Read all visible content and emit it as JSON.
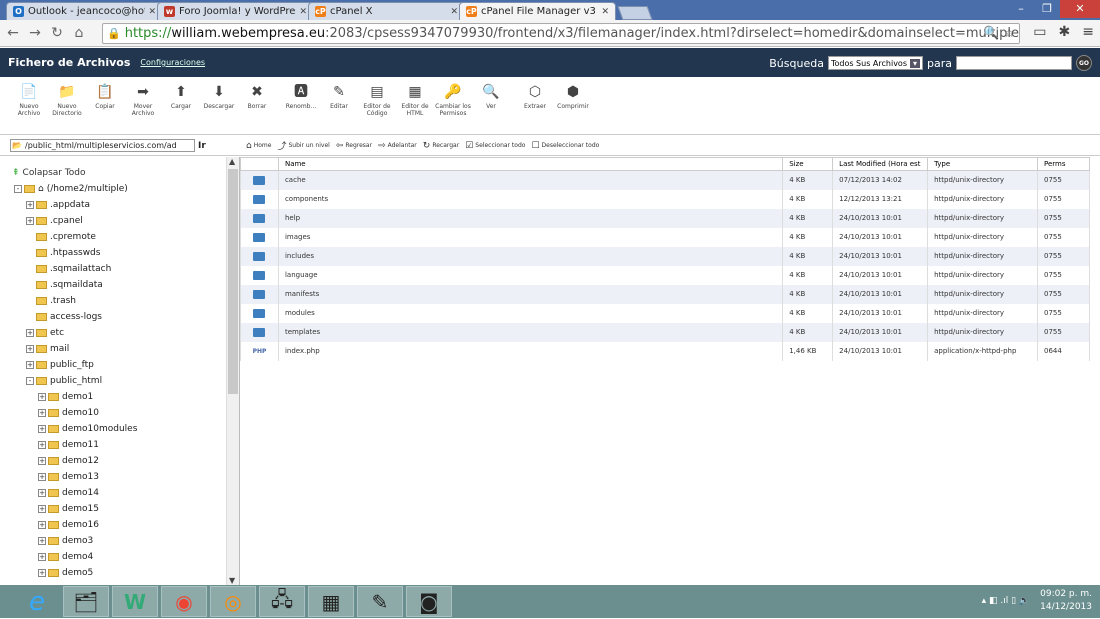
{
  "browser": {
    "tabs": [
      {
        "label": "Outlook - jeancoco@hotm",
        "icon": "outlook-icon",
        "color": "#1e6fc3",
        "letter": "O"
      },
      {
        "label": "Foro Joomla! y WordPress",
        "icon": "forum-icon",
        "color": "#c0392b",
        "letter": "w"
      },
      {
        "label": "cPanel X",
        "icon": "cpanel-icon",
        "color": "#ef7f1a",
        "letter": "cP"
      },
      {
        "label": "cPanel File Manager v3",
        "icon": "cpanel-icon",
        "color": "#ef7f1a",
        "letter": "cP"
      }
    ],
    "url_scheme": "https://",
    "url_host": "william.webempresa.eu",
    "url_rest": ":2083/cpsess9347079930/frontend/x3/filemanager/index.html?dirselect=homedir&domainselect=multipleservicios.com&d"
  },
  "header": {
    "title": "Fichero de Archivos",
    "config_link": "Configuraciones",
    "search_label": "Búsqueda",
    "search_select": "Todos Sus Archivos",
    "search_for": "para",
    "go": "GO"
  },
  "toolbar": [
    {
      "label": "Nuevo Archivo",
      "icon": "new-file-icon",
      "glyph": "📄"
    },
    {
      "label": "Nuevo Directorio",
      "icon": "new-folder-icon",
      "glyph": "📁"
    },
    {
      "label": "Copiar",
      "icon": "copy-icon",
      "glyph": "📋"
    },
    {
      "label": "Mover Archivo",
      "icon": "move-icon",
      "glyph": "➡"
    },
    {
      "label": "Cargar",
      "icon": "upload-icon",
      "glyph": "⬆"
    },
    {
      "label": "Descargar",
      "icon": "download-icon",
      "glyph": "⬇"
    },
    {
      "label": "Borrar",
      "icon": "delete-icon",
      "glyph": "✖"
    },
    {
      "label": "Renomb...",
      "icon": "rename-icon",
      "glyph": "🅰"
    },
    {
      "label": "Editar",
      "icon": "edit-icon",
      "glyph": "✎"
    },
    {
      "label": "Editor de Código",
      "icon": "code-editor-icon",
      "glyph": "▤"
    },
    {
      "label": "Editor de HTML",
      "icon": "html-editor-icon",
      "glyph": "▦"
    },
    {
      "label": "Cambiar los Permisos",
      "icon": "permissions-icon",
      "glyph": "🔑"
    },
    {
      "label": "Ver",
      "icon": "view-icon",
      "glyph": "🔍"
    },
    {
      "label": "Extraer",
      "icon": "extract-icon",
      "glyph": "⬡"
    },
    {
      "label": "Comprimir",
      "icon": "compress-icon",
      "glyph": "⬢"
    }
  ],
  "path": "/public_html/multipleservicios.com/ad",
  "path_go": "Ir",
  "actions": [
    {
      "label": "Home",
      "icon": "home-icon",
      "glyph": "⌂"
    },
    {
      "label": "Subir un nivel",
      "icon": "up-level-icon",
      "glyph": "⤴"
    },
    {
      "label": "Regresar",
      "icon": "back-icon",
      "glyph": "⇦"
    },
    {
      "label": "Adelantar",
      "icon": "forward-icon",
      "glyph": "⇨"
    },
    {
      "label": "Recargar",
      "icon": "reload-icon",
      "glyph": "↻"
    },
    {
      "label": "Seleccionar todo",
      "icon": "select-all-icon",
      "glyph": "☑"
    },
    {
      "label": "Deseleccionar todo",
      "icon": "unselect-all-icon",
      "glyph": "☐"
    }
  ],
  "tree": {
    "collapse": "Colapsar Todo",
    "root": "(/home2/multiple)",
    "items": [
      {
        "name": ".appdata",
        "pm": "+",
        "level": 1
      },
      {
        "name": ".cpanel",
        "pm": "+",
        "level": 1
      },
      {
        "name": ".cpremote",
        "pm": "",
        "level": 1
      },
      {
        "name": ".htpasswds",
        "pm": "",
        "level": 1
      },
      {
        "name": ".sqmailattach",
        "pm": "",
        "level": 1
      },
      {
        "name": ".sqmaildata",
        "pm": "",
        "level": 1
      },
      {
        "name": ".trash",
        "pm": "",
        "level": 1
      },
      {
        "name": "access-logs",
        "pm": "",
        "level": 1
      },
      {
        "name": "etc",
        "pm": "+",
        "level": 1
      },
      {
        "name": "mail",
        "pm": "+",
        "level": 1
      },
      {
        "name": "public_ftp",
        "pm": "+",
        "level": 1
      },
      {
        "name": "public_html",
        "pm": "-",
        "level": 1
      },
      {
        "name": "demo1",
        "pm": "+",
        "level": 2
      },
      {
        "name": "demo10",
        "pm": "+",
        "level": 2
      },
      {
        "name": "demo10modules",
        "pm": "+",
        "level": 2
      },
      {
        "name": "demo11",
        "pm": "+",
        "level": 2
      },
      {
        "name": "demo12",
        "pm": "+",
        "level": 2
      },
      {
        "name": "demo13",
        "pm": "+",
        "level": 2
      },
      {
        "name": "demo14",
        "pm": "+",
        "level": 2
      },
      {
        "name": "demo15",
        "pm": "+",
        "level": 2
      },
      {
        "name": "demo16",
        "pm": "+",
        "level": 2
      },
      {
        "name": "demo3",
        "pm": "+",
        "level": 2
      },
      {
        "name": "demo4",
        "pm": "+",
        "level": 2
      },
      {
        "name": "demo5",
        "pm": "+",
        "level": 2
      }
    ]
  },
  "table": {
    "headers": [
      "",
      "Name",
      "Size",
      "Last Modified (Hora est",
      "Type",
      "Perms"
    ],
    "rows": [
      {
        "kind": "dir",
        "name": "cache",
        "size": "4 KB",
        "modified": "07/12/2013 14:02",
        "type": "httpd/unix-directory",
        "perms": "0755"
      },
      {
        "kind": "dir",
        "name": "components",
        "size": "4 KB",
        "modified": "12/12/2013 13:21",
        "type": "httpd/unix-directory",
        "perms": "0755"
      },
      {
        "kind": "dir",
        "name": "help",
        "size": "4 KB",
        "modified": "24/10/2013 10:01",
        "type": "httpd/unix-directory",
        "perms": "0755"
      },
      {
        "kind": "dir",
        "name": "images",
        "size": "4 KB",
        "modified": "24/10/2013 10:01",
        "type": "httpd/unix-directory",
        "perms": "0755"
      },
      {
        "kind": "dir",
        "name": "includes",
        "size": "4 KB",
        "modified": "24/10/2013 10:01",
        "type": "httpd/unix-directory",
        "perms": "0755"
      },
      {
        "kind": "dir",
        "name": "language",
        "size": "4 KB",
        "modified": "24/10/2013 10:01",
        "type": "httpd/unix-directory",
        "perms": "0755"
      },
      {
        "kind": "dir",
        "name": "manifests",
        "size": "4 KB",
        "modified": "24/10/2013 10:01",
        "type": "httpd/unix-directory",
        "perms": "0755"
      },
      {
        "kind": "dir",
        "name": "modules",
        "size": "4 KB",
        "modified": "24/10/2013 10:01",
        "type": "httpd/unix-directory",
        "perms": "0755"
      },
      {
        "kind": "dir",
        "name": "templates",
        "size": "4 KB",
        "modified": "24/10/2013 10:01",
        "type": "httpd/unix-directory",
        "perms": "0755"
      },
      {
        "kind": "php",
        "name": "index.php",
        "size": "1,46 KB",
        "modified": "24/10/2013 10:01",
        "type": "application/x-httpd-php",
        "perms": "0644"
      }
    ]
  },
  "taskbar": {
    "apps": [
      {
        "icon": "ie-icon",
        "glyph": "e"
      },
      {
        "icon": "explorer-icon",
        "glyph": "🗂"
      },
      {
        "icon": "word-icon",
        "glyph": "W"
      },
      {
        "icon": "chrome-icon",
        "glyph": "◉"
      },
      {
        "icon": "firefox-icon",
        "glyph": "◎"
      },
      {
        "icon": "network-icon",
        "glyph": "🖧"
      },
      {
        "icon": "calculator-icon",
        "glyph": "▦"
      },
      {
        "icon": "greenshot-icon",
        "glyph": "✎"
      },
      {
        "icon": "screenshot-icon",
        "glyph": "◙"
      }
    ],
    "time": "09:02 p. m.",
    "date": "14/12/2013"
  }
}
